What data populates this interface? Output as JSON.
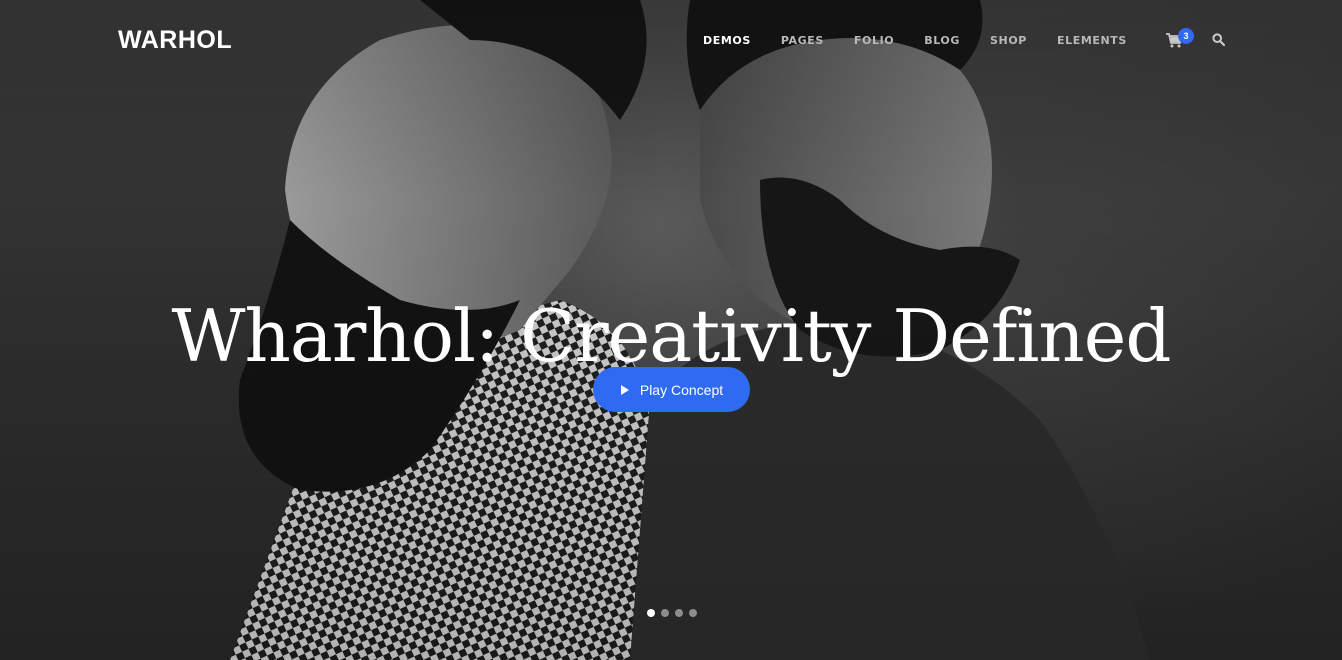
{
  "header": {
    "logo": "WARHOL",
    "nav": [
      {
        "label": "DEMOS",
        "active": true
      },
      {
        "label": "PAGES",
        "active": false
      },
      {
        "label": "FOLIO",
        "active": false
      },
      {
        "label": "BLOG",
        "active": false
      },
      {
        "label": "SHOP",
        "active": false
      },
      {
        "label": "ELEMENTS",
        "active": false
      }
    ],
    "cart": {
      "icon": "cart-icon",
      "count": "3"
    },
    "search": {
      "icon": "search-icon"
    }
  },
  "hero": {
    "headline": "Wharhol: Creativity Defined",
    "cta": {
      "label": "Play Concept",
      "icon": "play-icon"
    },
    "slides": {
      "count": 4,
      "active": 1
    }
  },
  "colors": {
    "accent": "#2e6bf2",
    "text": "#ffffff",
    "nav_inactive": "#b9b9b9"
  }
}
